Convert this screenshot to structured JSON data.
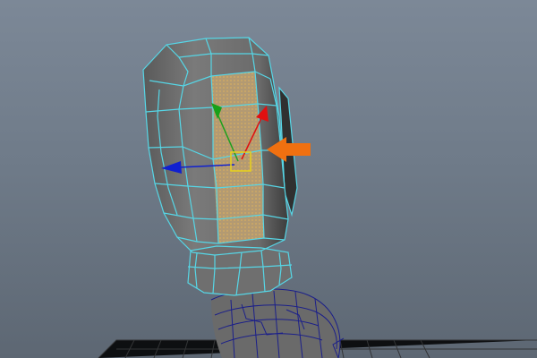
{
  "viewport": {
    "background_top": "#7c8897",
    "background_bottom": "#5d6773"
  },
  "colors": {
    "selection_wire": "#56d6e6",
    "unselected_wire": "#1b1f8a",
    "mesh_shade": "#6e6e6e",
    "selected_face": "#b39a72",
    "face_dots": "#e0b35a",
    "gizmo_x": "#e01010",
    "gizmo_y": "#18a018",
    "gizmo_z": "#1020d0",
    "gizmo_center": "#e8d21a",
    "callout_arrow": "#f07010"
  },
  "icons": {
    "move_manipulator": "move-tool-gizmo-icon",
    "callout": "orange-pointer-arrow-icon"
  }
}
